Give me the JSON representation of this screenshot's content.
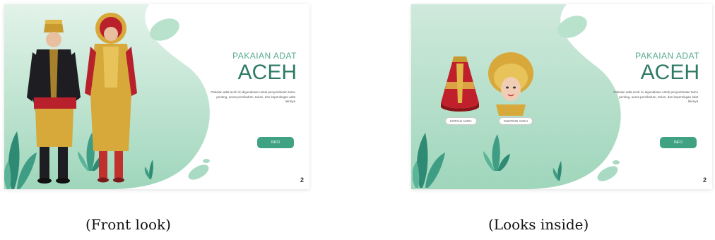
{
  "slides": [
    {
      "pre_title": "PAKAIAN ADAT",
      "title": "ACEH",
      "description": "Pakaian adat aceh ini digunakaan untuk penyambutan tamu penting, acara pernikahan, tarian, dan kepentingan adat lainnya",
      "button_label": "INFO",
      "page_number": "2"
    },
    {
      "pre_title": "PAKAIAN ADAT",
      "title": "ACEH",
      "description": "Pakaian adat aceh ini digunakaan untuk penyambutan tamu penting, acara pernikahan, tarian, dan kepentingan adat lainnya",
      "button_label": "INFO",
      "page_number": "2",
      "items": [
        {
          "label": "KOPIAH ACEH"
        },
        {
          "label": "SUNTING ACEH"
        }
      ]
    }
  ],
  "captions": {
    "front": "(Front look)",
    "inside": "(Looks inside)"
  },
  "colors": {
    "accent": "#3fa383",
    "blob_light": "#d8efe4",
    "blob_mid": "#a9dac3",
    "title": "#2f7a65"
  }
}
